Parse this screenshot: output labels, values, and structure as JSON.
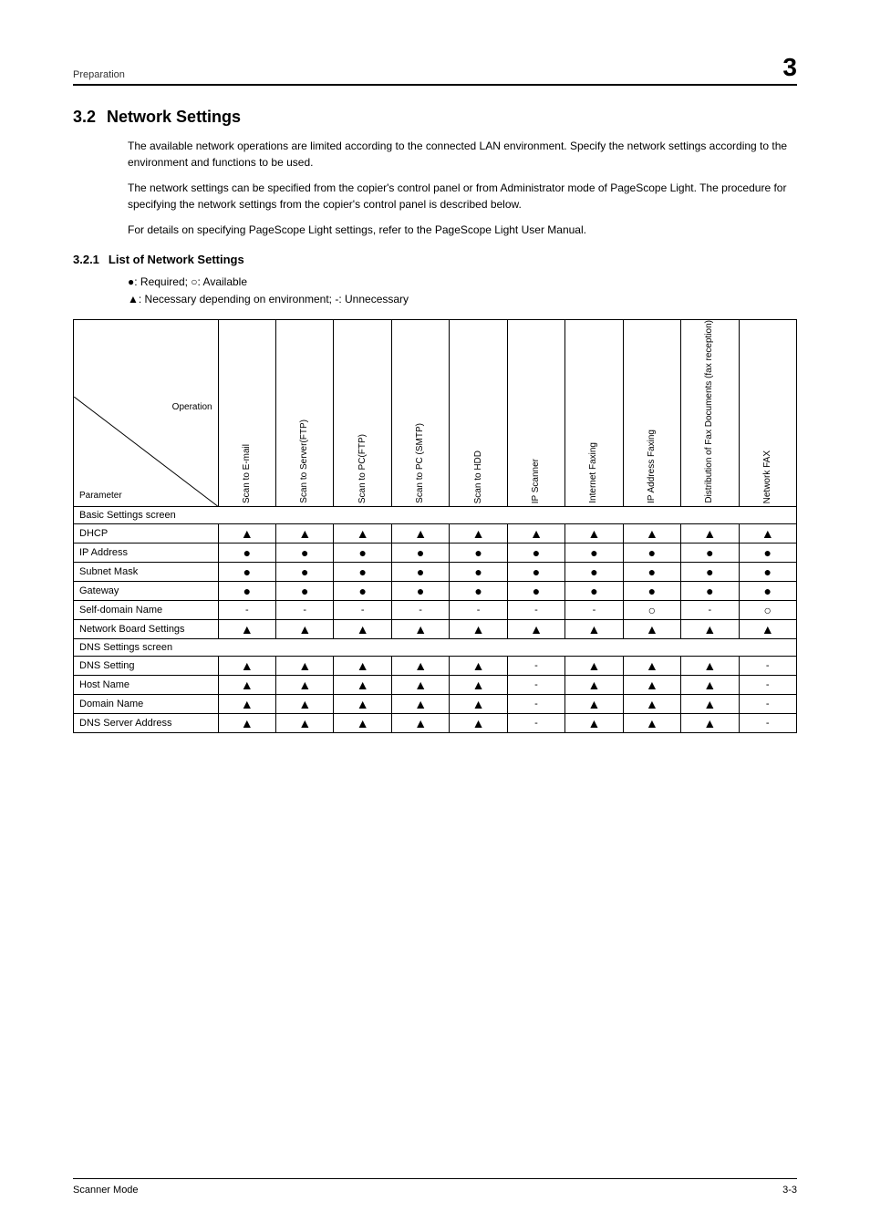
{
  "header": {
    "preparation_label": "Preparation",
    "chapter_number": "3"
  },
  "section": {
    "number": "3.2",
    "title": "Network Settings",
    "paragraph1": "The available network operations are limited according to the connected LAN environment. Specify the network settings according to the environment and functions to be used.",
    "paragraph2": "The network settings can be specified from the copier's control panel or from Administrator mode of PageScope Light. The procedure for specifying the network settings from the copier's control panel is described below.",
    "paragraph3": "For details on specifying PageScope Light settings, refer to the PageScope Light User Manual."
  },
  "subsection": {
    "number": "3.2.1",
    "title": "List of Network Settings",
    "legend1": "●: Required; ○: Available",
    "legend2": "▲: Necessary depending on environment; -: Unnecessary"
  },
  "table": {
    "corner_top": "Operation",
    "corner_bottom": "Parameter",
    "columns": [
      "Scan to E-mail",
      "Scan to Server(FTP)",
      "Scan to PC(FTP)",
      "Scan to PC (SMTP)",
      "Scan to HDD",
      "IP Scanner",
      "Internet Faxing",
      "IP Address Faxing",
      "Distribution of Fax Documents (fax reception)",
      "Network FAX"
    ],
    "sections": [
      {
        "name": "Basic Settings screen",
        "rows": [
          {
            "label": "DHCP",
            "values": [
              "▲",
              "▲",
              "▲",
              "▲",
              "▲",
              "▲",
              "▲",
              "▲",
              "▲",
              "▲"
            ]
          },
          {
            "label": "IP Address",
            "values": [
              "●",
              "●",
              "●",
              "●",
              "●",
              "●",
              "●",
              "●",
              "●",
              "●"
            ]
          },
          {
            "label": "Subnet Mask",
            "values": [
              "●",
              "●",
              "●",
              "●",
              "●",
              "●",
              "●",
              "●",
              "●",
              "●"
            ]
          },
          {
            "label": "Gateway",
            "values": [
              "●",
              "●",
              "●",
              "●",
              "●",
              "●",
              "●",
              "●",
              "●",
              "●"
            ]
          },
          {
            "label": "Self-domain Name",
            "values": [
              "-",
              "-",
              "-",
              "-",
              "-",
              "-",
              "-",
              "○",
              "-",
              "○"
            ]
          },
          {
            "label": "Network Board Settings",
            "values": [
              "▲",
              "▲",
              "▲",
              "▲",
              "▲",
              "▲",
              "▲",
              "▲",
              "▲",
              "▲"
            ]
          }
        ]
      },
      {
        "name": "DNS Settings screen",
        "rows": [
          {
            "label": "DNS Setting",
            "values": [
              "▲",
              "▲",
              "▲",
              "▲",
              "▲",
              "-",
              "▲",
              "▲",
              "▲",
              "-"
            ]
          },
          {
            "label": "Host Name",
            "values": [
              "▲",
              "▲",
              "▲",
              "▲",
              "▲",
              "-",
              "▲",
              "▲",
              "▲",
              "-"
            ]
          },
          {
            "label": "Domain Name",
            "values": [
              "▲",
              "▲",
              "▲",
              "▲",
              "▲",
              "-",
              "▲",
              "▲",
              "▲",
              "-"
            ]
          },
          {
            "label": "DNS Server Address",
            "values": [
              "▲",
              "▲",
              "▲",
              "▲",
              "▲",
              "-",
              "▲",
              "▲",
              "▲",
              "-"
            ]
          }
        ]
      }
    ]
  },
  "footer": {
    "left": "Scanner Mode",
    "right": "3-3"
  }
}
